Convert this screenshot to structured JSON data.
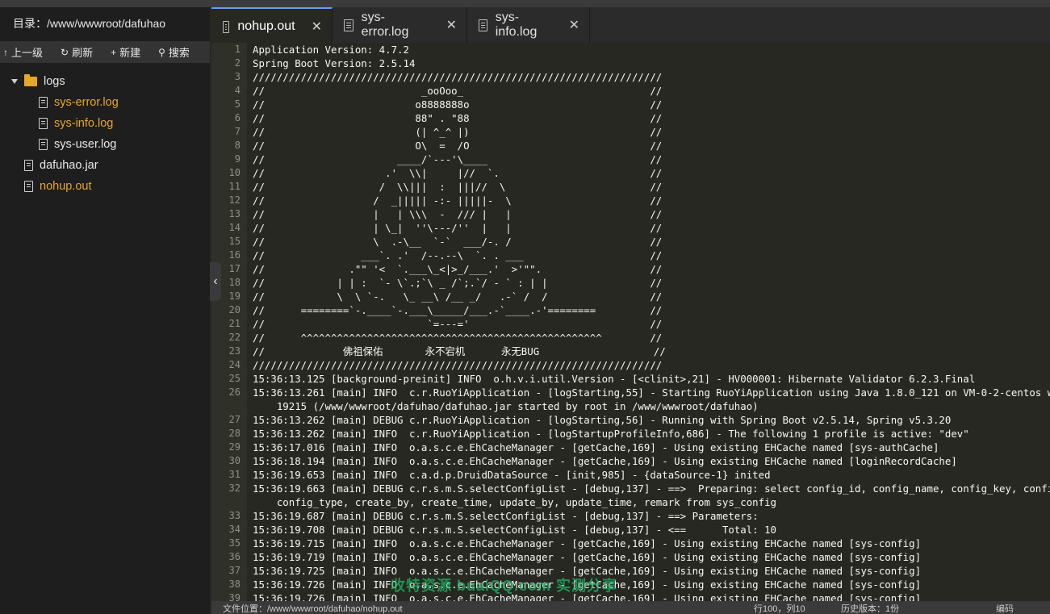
{
  "sidebar": {
    "title": "目录：/www/wwwroot/dafuhao",
    "toolbar": [
      {
        "icon": "arrow-up-icon",
        "glyph": "↑",
        "label": "上一级"
      },
      {
        "icon": "refresh-icon",
        "glyph": "↻",
        "label": "刷新"
      },
      {
        "icon": "plus-icon",
        "glyph": "+",
        "label": "新建"
      },
      {
        "icon": "search-icon",
        "glyph": "⚲",
        "label": "搜索"
      }
    ],
    "tree": {
      "folder": "logs",
      "children": [
        "sys-error.log",
        "sys-info.log",
        "sys-user.log"
      ],
      "files": [
        "dafuhao.jar",
        "nohup.out"
      ]
    }
  },
  "tabs": [
    {
      "label": "nohup.out",
      "active": true
    },
    {
      "label": "sys-error.log",
      "active": false
    },
    {
      "label": "sys-info.log",
      "active": false
    }
  ],
  "editor": {
    "lines": [
      {
        "n": "1",
        "t": "Application Version: 4.7.2"
      },
      {
        "n": "2",
        "t": "Spring Boot Version: 2.5.14"
      },
      {
        "n": "3",
        "t": "////////////////////////////////////////////////////////////////////"
      },
      {
        "n": "4",
        "t": "//                          _ooOoo_                               //"
      },
      {
        "n": "5",
        "t": "//                         o8888888o                              //"
      },
      {
        "n": "6",
        "t": "//                         88\" . \"88                              //"
      },
      {
        "n": "7",
        "t": "//                         (| ^_^ |)                              //"
      },
      {
        "n": "8",
        "t": "//                         O\\  =  /O                              //"
      },
      {
        "n": "9",
        "t": "//                      ____/`---'\\____                           //"
      },
      {
        "n": "10",
        "t": "//                    .'  \\\\|     |//  `.                         //"
      },
      {
        "n": "11",
        "t": "//                   /  \\\\|||  :  |||//  \\                        //"
      },
      {
        "n": "12",
        "t": "//                  /  _||||| -:- |||||-  \\                       //"
      },
      {
        "n": "13",
        "t": "//                  |   | \\\\\\  -  /// |   |                       //"
      },
      {
        "n": "14",
        "t": "//                  | \\_|  ''\\---/''  |   |                       //"
      },
      {
        "n": "15",
        "t": "//                  \\  .-\\__  `-`  ___/-. /                       //"
      },
      {
        "n": "16",
        "t": "//                ___`. .'  /--.--\\  `. . ___                     //"
      },
      {
        "n": "17",
        "t": "//              .\"\" '<  `.___\\_<|>_/___.'  >'\"\".                  //"
      },
      {
        "n": "18",
        "t": "//            | | :  `- \\`.;`\\ _ /`;.`/ - ` : | |                 //"
      },
      {
        "n": "19",
        "t": "//            \\  \\ `-.   \\_ __\\ /__ _/   .-` /  /                 //"
      },
      {
        "n": "20",
        "t": "//      ========`-.____`-.___\\_____/___.-`____.-'========         //"
      },
      {
        "n": "21",
        "t": "//                           `=---='                              //"
      },
      {
        "n": "22",
        "t": "//      ^^^^^^^^^^^^^^^^^^^^^^^^^^^^^^^^^^^^^^^^^^^^^^^^^^        //"
      },
      {
        "n": "23",
        "t": "//             佛祖保佑       永不宕机      永无BUG                   //"
      },
      {
        "n": "24",
        "t": "////////////////////////////////////////////////////////////////////"
      },
      {
        "n": "25",
        "t": "15:36:13.125 [background-preinit] INFO  o.h.v.i.util.Version - [<clinit>,21] - HV000001: Hibernate Validator 6.2.3.Final"
      },
      {
        "n": "26",
        "t": "15:36:13.261 [main] INFO  c.r.RuoYiApplication - [logStarting,55] - Starting RuoYiApplication using Java 1.8.0_121 on VM-0-2-centos with PID\n    19215 (/www/wwwroot/dafuhao/dafuhao.jar started by root in /www/wwwroot/dafuhao)",
        "wrap": true
      },
      {
        "n": "27",
        "t": "15:36:13.262 [main] DEBUG c.r.RuoYiApplication - [logStarting,56] - Running with Spring Boot v2.5.14, Spring v5.3.20"
      },
      {
        "n": "28",
        "t": "15:36:13.262 [main] INFO  c.r.RuoYiApplication - [logStartupProfileInfo,686] - The following 1 profile is active: \"dev\""
      },
      {
        "n": "29",
        "t": "15:36:17.016 [main] INFO  o.a.s.c.e.EhCacheManager - [getCache,169] - Using existing EHCache named [sys-authCache]"
      },
      {
        "n": "30",
        "t": "15:36:18.194 [main] INFO  o.a.s.c.e.EhCacheManager - [getCache,169] - Using existing EHCache named [loginRecordCache]"
      },
      {
        "n": "31",
        "t": "15:36:19.653 [main] INFO  c.a.d.p.DruidDataSource - [init,985] - {dataSource-1} inited"
      },
      {
        "n": "32",
        "t": "15:36:19.663 [main] DEBUG c.r.s.m.S.selectConfigList - [debug,137] - ==>  Preparing: select config_id, config_name, config_key, config_value,\n    config_type, create_by, create_time, update_by, update_time, remark from sys_config",
        "wrap": true
      },
      {
        "n": "33",
        "t": "15:36:19.687 [main] DEBUG c.r.s.m.S.selectConfigList - [debug,137] - ==> Parameters: "
      },
      {
        "n": "34",
        "t": "15:36:19.708 [main] DEBUG c.r.s.m.S.selectConfigList - [debug,137] - <==      Total: 10"
      },
      {
        "n": "35",
        "t": "15:36:19.715 [main] INFO  o.a.s.c.e.EhCacheManager - [getCache,169] - Using existing EHCache named [sys-config]"
      },
      {
        "n": "36",
        "t": "15:36:19.719 [main] INFO  o.a.s.c.e.EhCacheManager - [getCache,169] - Using existing EHCache named [sys-config]"
      },
      {
        "n": "37",
        "t": "15:36:19.725 [main] INFO  o.a.s.c.e.EhCacheManager - [getCache,169] - Using existing EHCache named [sys-config]"
      },
      {
        "n": "38",
        "t": "15:36:19.726 [main] INFO  o.a.s.c.e.EhCacheManager - [getCache,169] - Using existing EHCache named [sys-config]"
      },
      {
        "n": "39",
        "t": "15:36:19.726 [main] INFO  o.a.s.c.e.EhCacheManager - [getCache,169] - Using existing EHCache named [sys-config]"
      }
    ]
  },
  "watermark": "收特资源 buaiQQ.com 实测分享",
  "statusbar": {
    "file_path": "文件位置：/www/wwwroot/dafuhao/nohup.out",
    "cursor": "行100，列10",
    "history": "历史版本：1份",
    "encoding_prefix": "编码"
  },
  "colors": {
    "accent": "#e6a72b",
    "tab_indicator": "#6a9cf0",
    "editor_bg": "#272822"
  }
}
